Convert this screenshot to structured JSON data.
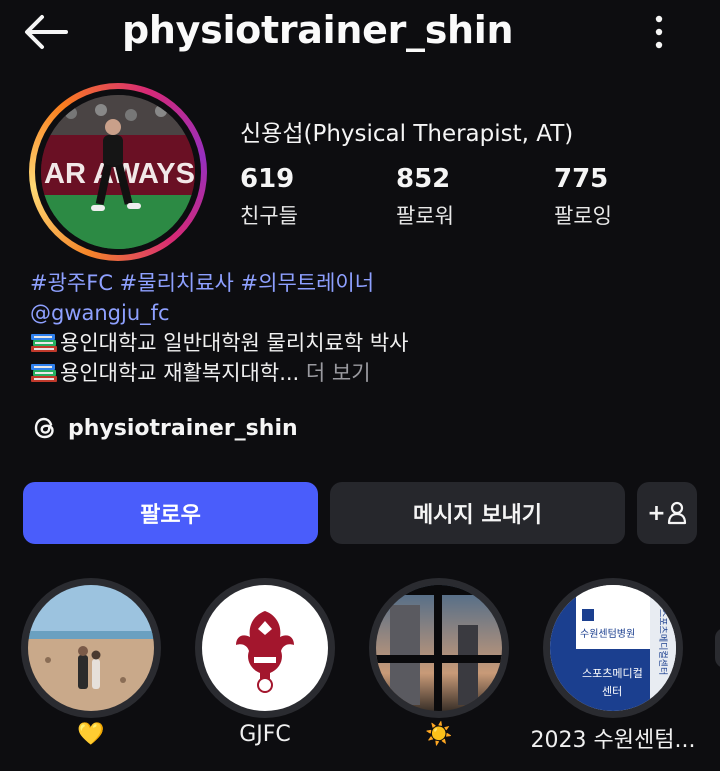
{
  "header": {
    "username": "physiotrainer_shin",
    "back_icon": "arrow-left-icon",
    "more_icon": "more-vertical-icon"
  },
  "profile": {
    "display_name": "신용섭(Physical Therapist, AT)",
    "avatar_text": "AR AWAYS",
    "stats": [
      {
        "value": "619",
        "label": "친구들"
      },
      {
        "value": "852",
        "label": "팔로워"
      },
      {
        "value": "775",
        "label": "팔로잉"
      }
    ]
  },
  "bio": {
    "hashtags": "#광주FC #물리치료사 #의무트레이너",
    "mention": "@gwangju_fc",
    "line1": "용인대학교 일반대학원 물리치료학 박사",
    "line2": "용인대학교 재활복지대학...",
    "more": "더 보기"
  },
  "threads": {
    "icon": "threads-icon",
    "handle": "physiotrainer_shin"
  },
  "buttons": {
    "follow": "팔로우",
    "message": "메시지 보내기",
    "add_user": "+"
  },
  "highlights": [
    {
      "label": "💛"
    },
    {
      "label": "GJFC"
    },
    {
      "label": "☀️"
    },
    {
      "label": "2023 수원센텀..."
    }
  ],
  "highlight_images": {
    "hl4_text1": "수원센텀병원",
    "hl4_text2": "스포츠메디컬",
    "hl4_text3": "센터",
    "hl4_text4": "스포츠메디컬센터"
  },
  "colors": {
    "background": "#0d0d10",
    "accent": "#4a5dfb",
    "link": "#8ea0ff",
    "secondary_button": "#26272c"
  }
}
